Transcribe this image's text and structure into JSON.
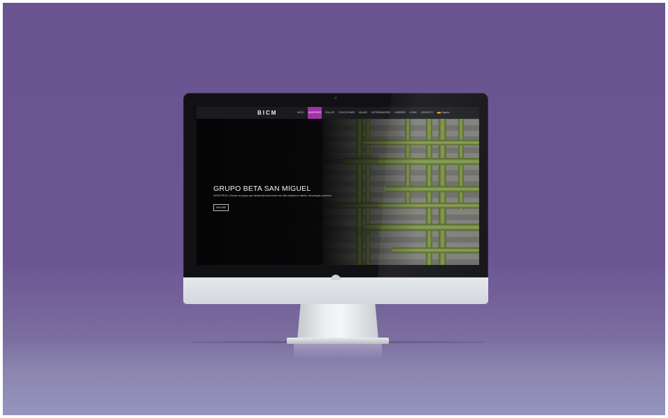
{
  "site": {
    "brand": "BICM",
    "nav_items": [
      {
        "label": "INICIO",
        "active": false
      },
      {
        "label": "NOSOTROS",
        "active": true
      },
      {
        "label": "ROLLOS",
        "active": false
      },
      {
        "label": "COLECCIONES",
        "active": false
      },
      {
        "label": "HILADO",
        "active": false
      },
      {
        "label": "DISTRIBUIDORES",
        "active": false
      },
      {
        "label": "CAREERS",
        "active": false
      },
      {
        "label": "LOGIN",
        "active": false
      },
      {
        "label": "CONTACTO",
        "active": false
      },
      {
        "label": "Español",
        "active": false
      }
    ],
    "hero": {
      "title": "GRUPO BETA SAN MIGUEL",
      "subtitle": "NOSOTROS | Somos un grupo que desarrolla soluciones con alta calidad en diseño, tecnología y servicio",
      "button_label": "VER MÁS"
    }
  },
  "colors": {
    "background": "#6a5490",
    "accent": "#a133a6"
  }
}
